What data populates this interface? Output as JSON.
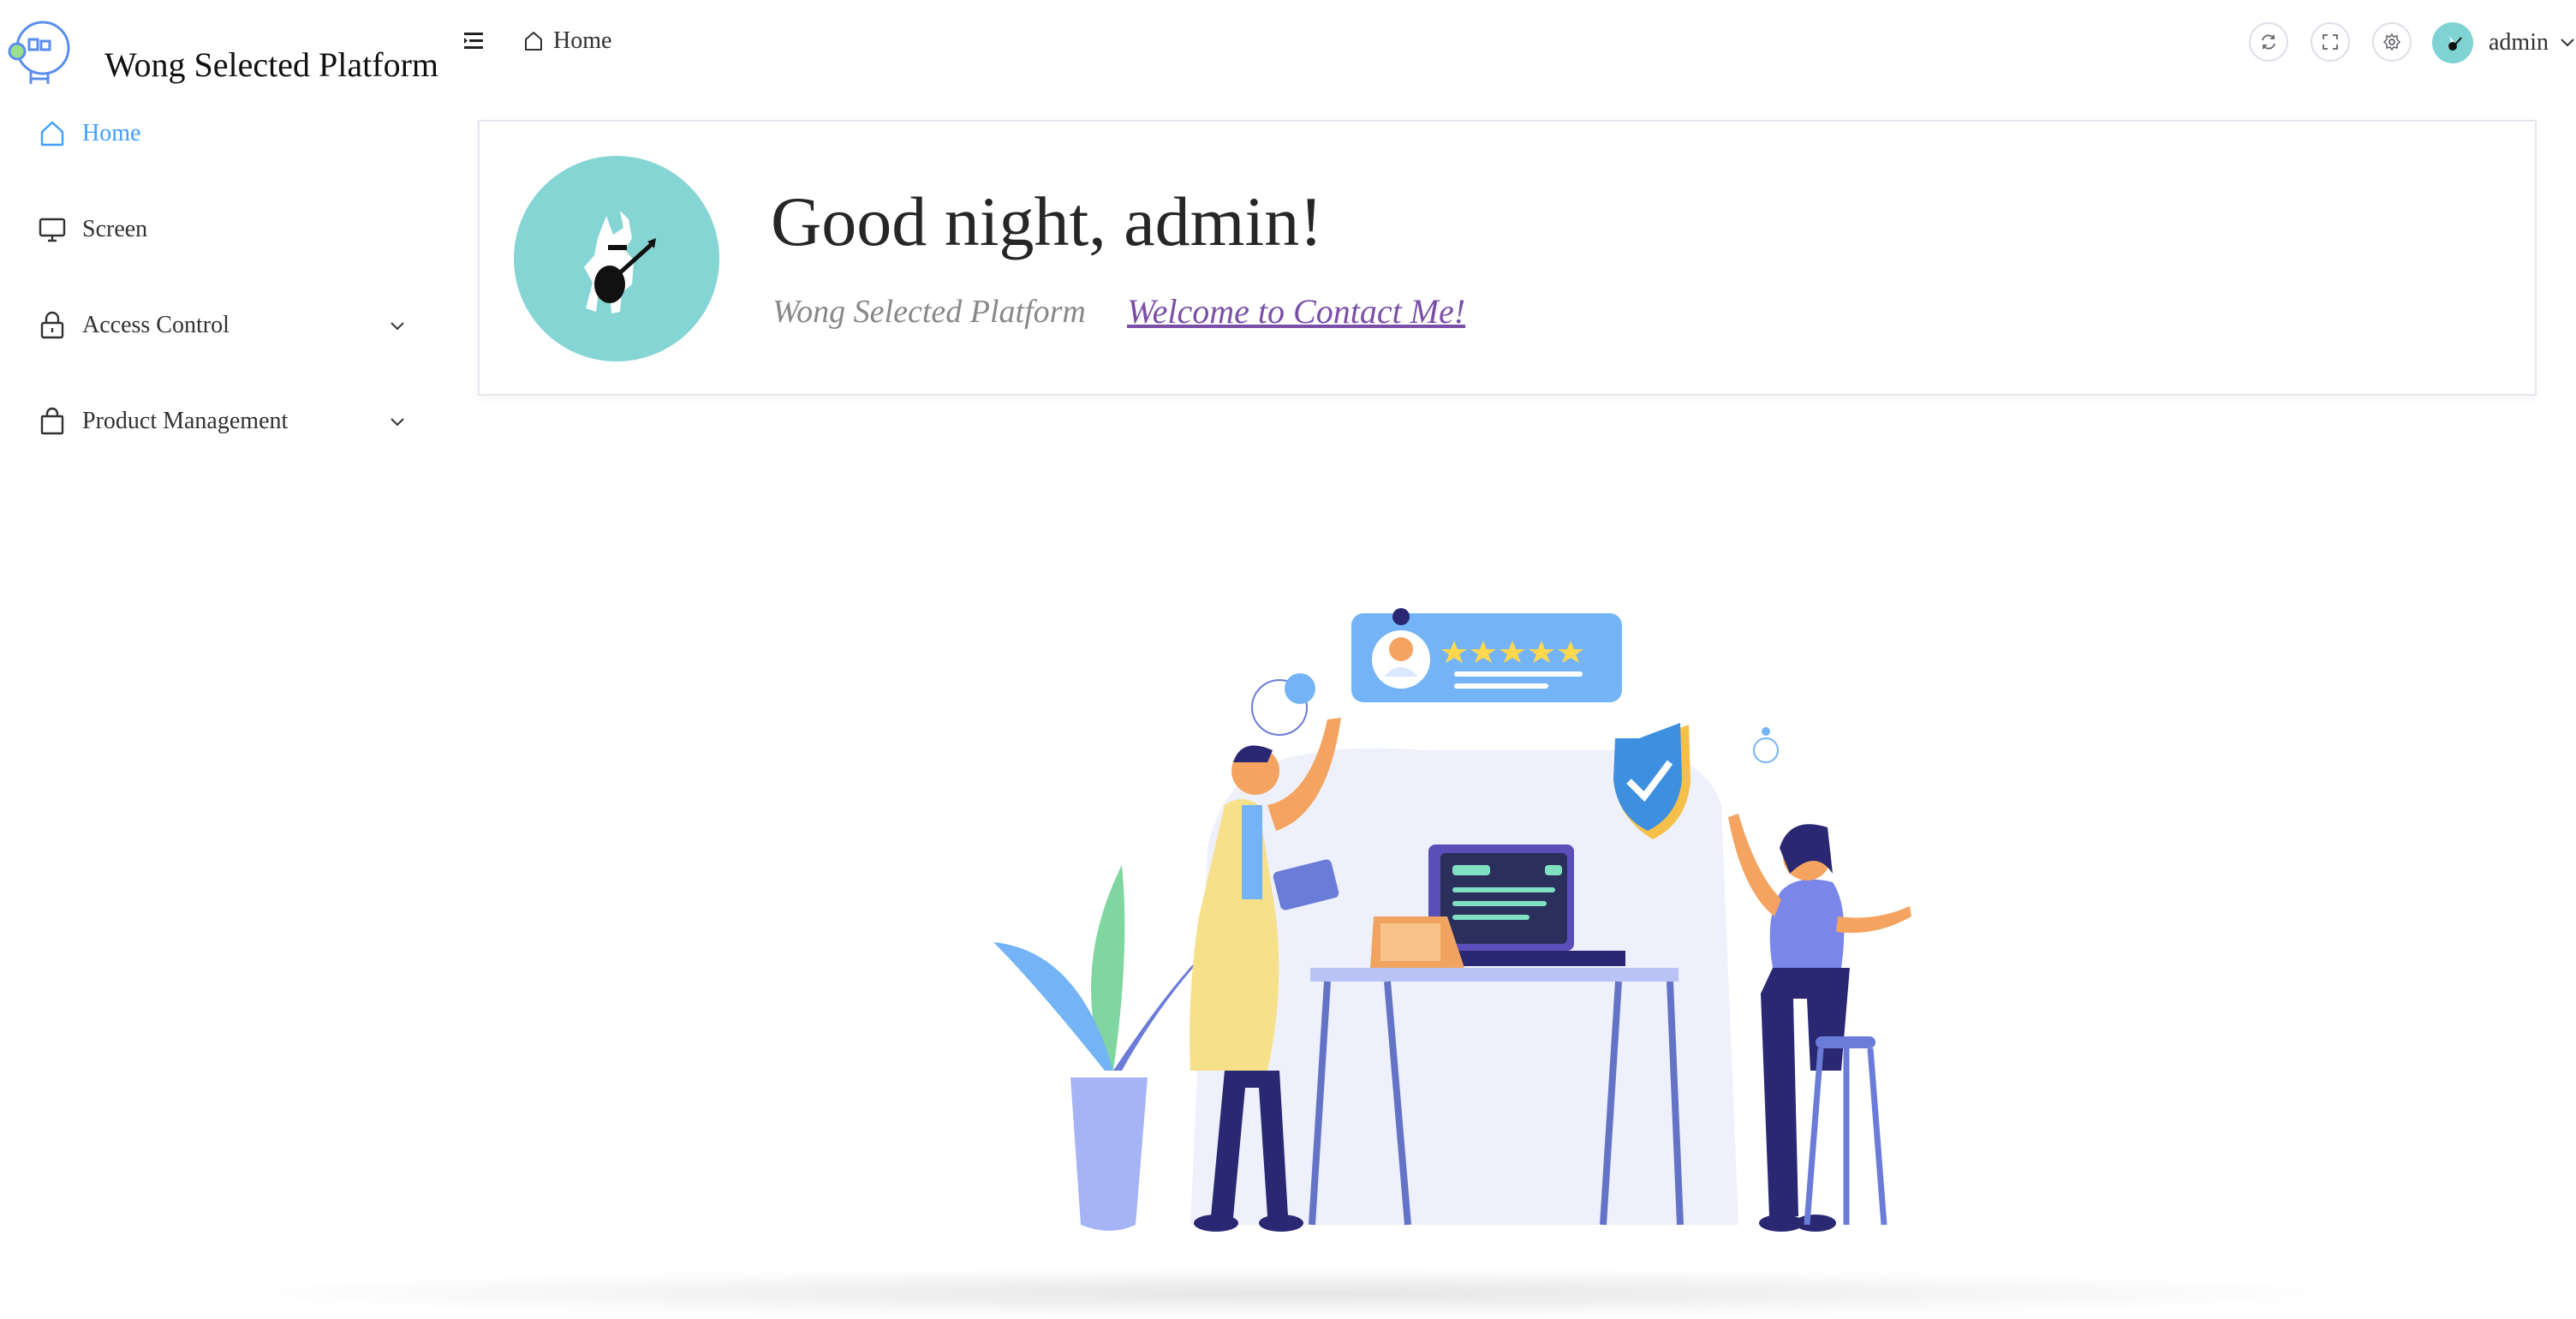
{
  "brand": {
    "name": "Wong Selected Platform"
  },
  "sidebar": {
    "items": [
      {
        "label": "Home",
        "icon": "home-icon",
        "active": true
      },
      {
        "label": "Screen",
        "icon": "monitor-icon",
        "active": false
      },
      {
        "label": "Access Control",
        "icon": "lock-icon",
        "active": false,
        "expandable": true
      },
      {
        "label": "Product Management",
        "icon": "bag-icon",
        "active": false,
        "expandable": true
      }
    ]
  },
  "header": {
    "breadcrumb": "Home",
    "user": "admin",
    "buttons": [
      "refresh-icon",
      "fullscreen-icon",
      "settings-icon"
    ]
  },
  "welcome": {
    "greeting": "Good night, admin!",
    "subtitle": "Wong Selected Platform",
    "contact_link": "Welcome to Contact Me!"
  },
  "colors": {
    "accent": "#409eff",
    "avatar_bg": "#86d5d5",
    "link": "#7b4fa8"
  }
}
